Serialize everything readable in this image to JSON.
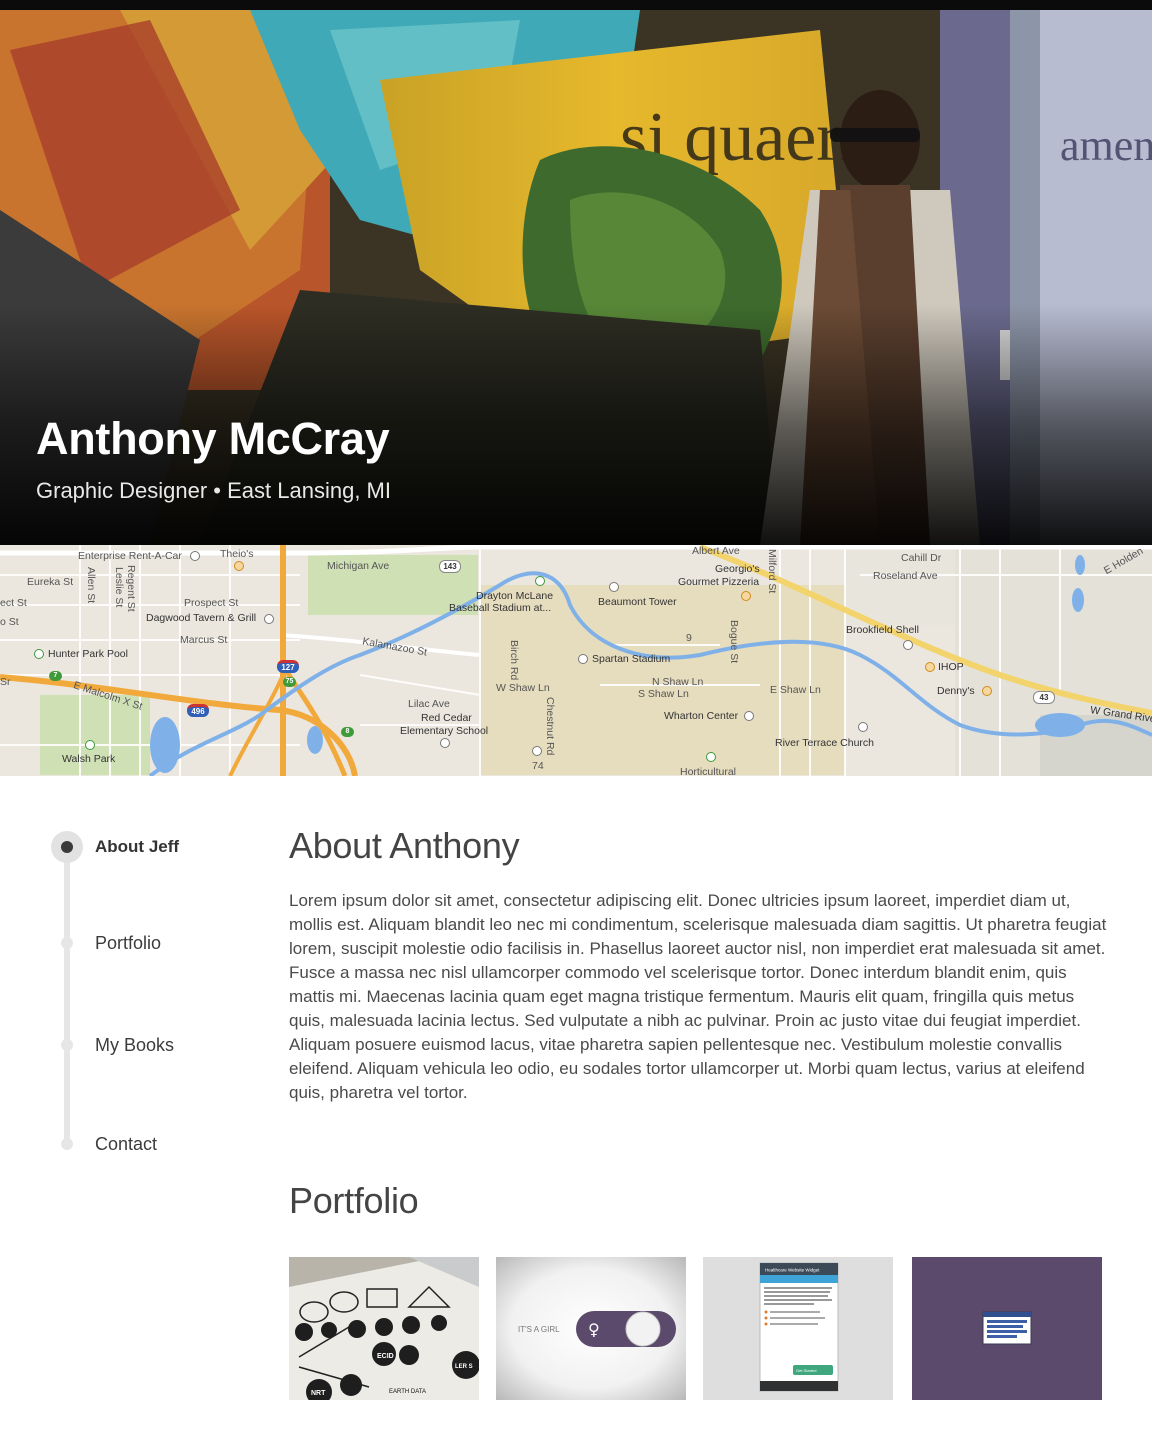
{
  "profile": {
    "name": "Anthony McCray",
    "subtitle": "Graphic  Designer • East Lansing, MI"
  },
  "map": {
    "labels": {
      "enterprise": "Enterprise Rent-A-Car",
      "theios": "Theio's",
      "michigan_ave": "Michigan Ave",
      "albert_ave": "Albert Ave",
      "georgios": "Georgio's",
      "gourmet_pizzeria": "Gourmet Pizzeria",
      "milford_st": "Milford St",
      "cahill_dr": "Cahill Dr",
      "roseland_ave": "Roseland Ave",
      "e_holden": "E Holden",
      "eureka_st": "Eureka St",
      "allen_st": "Allen St",
      "regent_st": "Regent St",
      "leslie_st": "Leslie St",
      "ect_st": "ect St",
      "prospect_st": "Prospect St",
      "drayton": "Drayton McLane",
      "baseball_stadium": "Baseball Stadium at...",
      "beaumont": "Beaumont Tower",
      "o_st": "o St",
      "dagwood": "Dagwood Tavern & Grill",
      "marcus_st": "Marcus St",
      "kalamazoo_st": "Kalamazoo St",
      "brookfield": "Brookfield Shell",
      "hunter_park": "Hunter Park Pool",
      "birch_rd": "Birch Rd",
      "spartan_stadium": "Spartan Stadium",
      "bogue_st": "Bogue St",
      "ihop": "IHOP",
      "w_shaw_ln": "W Shaw Ln",
      "n_shaw_ln": "N Shaw Ln",
      "s_shaw_ln": "S Shaw Ln",
      "e_shaw_ln": "E Shaw Ln",
      "dennys": "Denny's",
      "e_malcolm": "E Malcolm X St",
      "lilac_ave": "Lilac Ave",
      "red_cedar": "Red Cedar",
      "elementary": "Elementary School",
      "chestnut_rd": "Chestnut Rd",
      "wharton": "Wharton Center",
      "w_grand_river": "W Grand River",
      "river_terrace": "River Terrace Church",
      "walsh_park": "Walsh Park",
      "horticultural": "Horticultural",
      "sr": "Sr"
    },
    "shields": {
      "r143": "143",
      "r127": "127",
      "r75": "75",
      "r496": "496",
      "r7": "7",
      "r8": "8",
      "r43": "43",
      "r74": "74",
      "r9": "9"
    }
  },
  "nav": {
    "items": [
      {
        "label": "About Jeff",
        "active": true
      },
      {
        "label": "Portfolio",
        "active": false
      },
      {
        "label": "My Books",
        "active": false
      },
      {
        "label": "Contact",
        "active": false
      }
    ]
  },
  "about": {
    "title": "About Anthony",
    "body": "Lorem ipsum dolor sit amet, consectetur adipiscing elit. Donec ultricies ipsum laoreet, imperdiet diam ut, mollis est. Aliquam blandit leo nec mi condimentum, scelerisque malesuada diam sagittis. Ut pharetra feugiat lorem, suscipit molestie odio facilisis in. Phasellus laoreet auctor nisl, non imperdiet erat malesuada sit amet. Fusce a massa nec nisl ullamcorper commodo vel scelerisque tortor. Donec interdum blandit enim, quis mattis mi. Maecenas lacinia quam eget magna tristique fermentum. Mauris elit quam, fringilla quis metus quis, malesuada lacinia lectus. Sed vulputate a nibh ac pulvinar. Proin ac justo vitae dui feugiat imperdiet. Aliquam posuere euismod lacus, vitae pharetra sapien pellentesque nec. Vestibulum molestie convallis eleifend. Aliquam vehicula leo odio, eu sodales tortor ullamcorper ut. Morbi quam lectus, varius at eleifend quis, pharetra vel tortor."
  },
  "portfolio": {
    "title": "Portfolio",
    "thumbs": [
      {
        "kind": "sketch",
        "texts": [
          "ECID",
          "EARTH DATA",
          "NRT",
          "LER S"
        ]
      },
      {
        "kind": "toggle",
        "texts": [
          "IT'S A GIRL"
        ]
      },
      {
        "kind": "widget",
        "texts": [
          "Healthcare Website Widget",
          "Get Started"
        ]
      },
      {
        "kind": "purple",
        "texts": []
      }
    ]
  },
  "colors": {
    "accent_purple": "#5b4a6b",
    "map_road_orange": "#f2a93b",
    "map_water": "#7fb1e8",
    "text_dark": "#333333"
  }
}
